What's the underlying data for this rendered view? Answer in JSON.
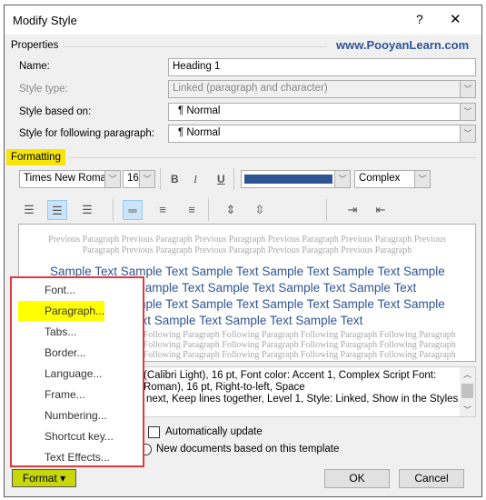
{
  "dialog": {
    "title": "Modify Style",
    "help": "?",
    "close": "✕",
    "watermark": "www.PooyanLearn.com"
  },
  "properties": {
    "heading": "Properties",
    "name_label": "Name:",
    "name_value": "Heading 1",
    "style_type_label": "Style type:",
    "style_type_value": "Linked (paragraph and character)",
    "based_on_label": "Style based on:",
    "based_on_value": "¶ Normal",
    "following_label": "Style for following paragraph:",
    "following_value": "¶ Normal"
  },
  "formatting": {
    "heading": "Formatting",
    "font": "Times New Roman",
    "size": "16",
    "bold": "B",
    "italic": "I",
    "underline": "U",
    "color": "#2f5496",
    "script": "Complex"
  },
  "preview": {
    "previous": [
      "Previous Paragraph Previous Paragraph Previous Paragraph Previous Paragraph Previous Paragraph Previous",
      "Paragraph Previous Paragraph Previous Paragraph Previous Paragraph Previous Paragraph"
    ],
    "sample": [
      "Sample Text Sample Text Sample Text Sample Text Sample Text Sample",
      "Sample Text Sample Text Sample Text Sample Text Sample Text",
      "Sample Text Sample Text Sample Text Sample Text Sample Text Sample",
      "Sample Text Sample Text Sample Text Sample Text"
    ],
    "following": [
      "Following Paragraph Following Paragraph Following Paragraph Following Paragraph Following Paragraph",
      "Following Paragraph Following Paragraph Following Paragraph Following Paragraph Following Paragraph",
      "Following Paragraph Following Paragraph Following Paragraph Following Paragraph Following Paragraph"
    ]
  },
  "description": [
    "(Calibri Light), 16 pt, Font color: Accent 1, Complex Script Font:",
    "Roman), 16 pt, Right-to-left, Space",
    "next, Keep lines together, Level 1, Style: Linked, Show in the Styles"
  ],
  "options": {
    "auto_update": "Automatically update",
    "new_docs": "New documents based on this template"
  },
  "format_menu": {
    "items": [
      "Font...",
      "Paragraph...",
      "Tabs...",
      "Border...",
      "Language...",
      "Frame...",
      "Numbering...",
      "Shortcut key...",
      "Text Effects..."
    ],
    "highlighted": "Paragraph...",
    "highlight_color": "#ffff00",
    "border_color": "#e0383e"
  },
  "buttons": {
    "format": "Format ▾",
    "format_color": "#c6d80a",
    "ok": "OK",
    "cancel": "Cancel"
  }
}
